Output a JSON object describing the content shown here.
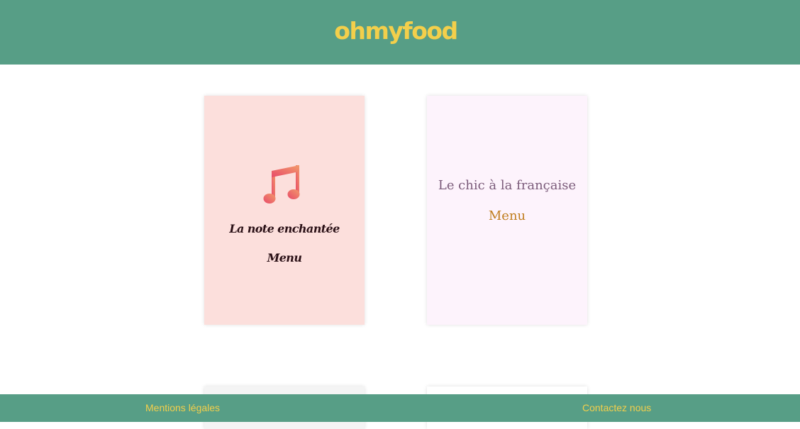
{
  "header": {
    "logo": "ohmyfood"
  },
  "restaurants": [
    {
      "name": "La note enchantée",
      "menu_label": "Menu",
      "icon": "music-note-icon",
      "background": "#fcdfdc"
    },
    {
      "name": "Le chic à la française",
      "menu_label": "Menu",
      "background": "#fdf3fc"
    }
  ],
  "footer": {
    "legal_label": "Mentions légales",
    "contact_label": "Contactez nous"
  },
  "colors": {
    "brand_green": "#579e86",
    "brand_yellow": "#f3cf4b"
  }
}
